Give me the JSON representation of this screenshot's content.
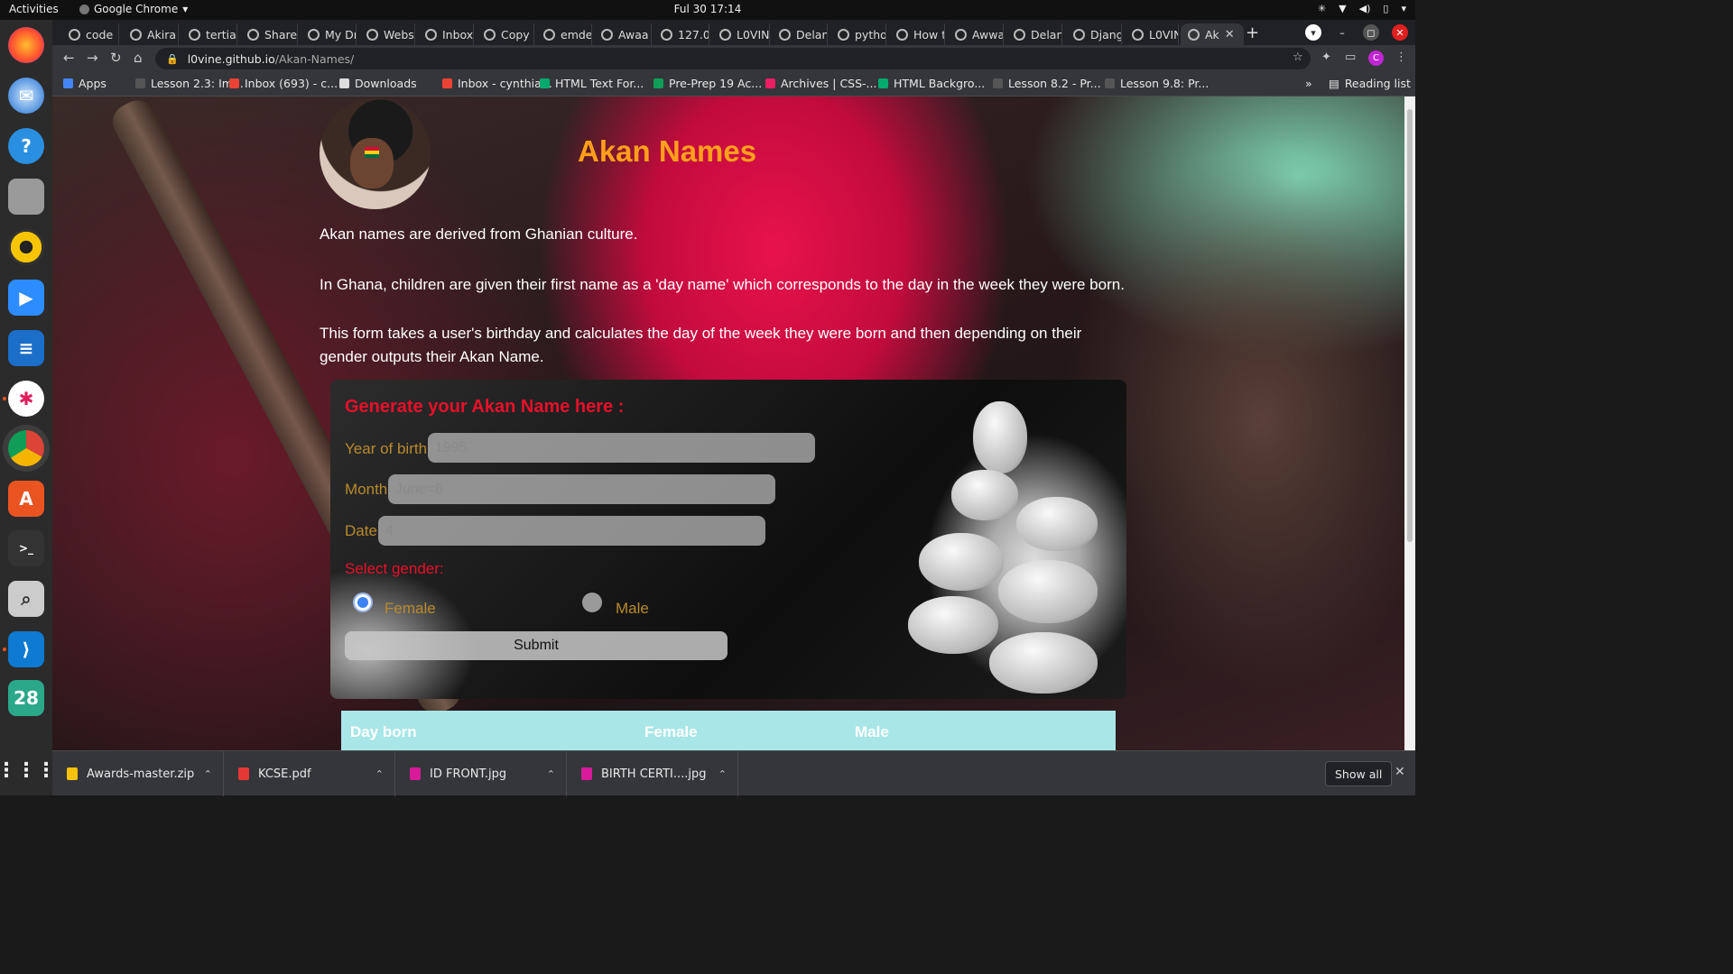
{
  "os": {
    "activities": "Activities",
    "app_name": "Google Chrome",
    "clock": "Ful 30  17:14"
  },
  "dock": {
    "items": [
      "firefox",
      "thunderbird",
      "help",
      "files",
      "rhythmbox",
      "zoom",
      "libreoffice-writer",
      "slack",
      "chrome",
      "software-center",
      "terminal",
      "magnifier",
      "vscode",
      "calendar",
      "show-apps"
    ],
    "calendar_day": "28"
  },
  "tabs": [
    {
      "label": "code"
    },
    {
      "label": "Akira"
    },
    {
      "label": "tertia"
    },
    {
      "label": "Share"
    },
    {
      "label": "My Dr"
    },
    {
      "label": "Webs"
    },
    {
      "label": "Inbox"
    },
    {
      "label": "Copy"
    },
    {
      "label": "emde"
    },
    {
      "label": "Awaa"
    },
    {
      "label": "127.0"
    },
    {
      "label": "L0VIN"
    },
    {
      "label": "Delan"
    },
    {
      "label": "pytho"
    },
    {
      "label": "How t"
    },
    {
      "label": "Awwa"
    },
    {
      "label": "Delan"
    },
    {
      "label": "Djang"
    },
    {
      "label": "L0VIN"
    },
    {
      "label": "Ak",
      "active": true
    }
  ],
  "address_bar": {
    "domain": "l0vine.github.io",
    "path": "/Akan-Names/"
  },
  "profile_initial": "C",
  "bookmarks": {
    "items": [
      {
        "label": "Apps",
        "color": "#4285f4"
      },
      {
        "label": "Lesson 2.3: Im...",
        "color": "#555555"
      },
      {
        "label": "Inbox (693) - c...",
        "color": "#ea4335"
      },
      {
        "label": "Downloads",
        "color": "#dddddd"
      },
      {
        "label": "Inbox - cynthia...",
        "color": "#ea4335"
      },
      {
        "label": "HTML Text For...",
        "color": "#04aa6d"
      },
      {
        "label": "Pre-Prep 19 Ac...",
        "color": "#0f9d58"
      },
      {
        "label": "Archives | CSS-...",
        "color": "#e91e63"
      },
      {
        "label": "HTML Backgro...",
        "color": "#04aa6d"
      },
      {
        "label": "Lesson 8.2 - Pr...",
        "color": "#555555"
      },
      {
        "label": "Lesson 9.8: Pr...",
        "color": "#555555"
      }
    ],
    "more": "»",
    "reading_list": "Reading list"
  },
  "page": {
    "title": "Akan Names",
    "paragraph1": "Akan names are derived from Ghanian culture.",
    "paragraph2": "In Ghana, children are given their first name as a 'day name' which corresponds to the day in the week they were born.",
    "paragraph3_line1": "This form takes a user's birthday and calculates the day of the week they were born and then depending on their",
    "paragraph3_line2": "gender outputs their Akan Name.",
    "form": {
      "heading": "Generate your Akan Name here :",
      "year_label": "Year of birth",
      "year_placeholder": "1995",
      "month_label": "Month",
      "month_placeholder": "June=6",
      "date_label": "Date",
      "date_placeholder": "4",
      "gender_label": "Select gender:",
      "female_label": "Female",
      "male_label": "Male",
      "selected_gender": "Female",
      "submit_label": "Submit"
    },
    "table": {
      "headers": [
        "Day born",
        "Female",
        "Male"
      ]
    }
  },
  "downloads": {
    "items": [
      {
        "name": "Awards-master.zip",
        "color": "#f4c20d"
      },
      {
        "name": "KCSE.pdf",
        "color": "#e53935"
      },
      {
        "name": "ID FRONT.jpg",
        "color": "#d81b9a"
      },
      {
        "name": "BIRTH CERTI....jpg",
        "color": "#d81b9a"
      }
    ],
    "show_all": "Show all"
  }
}
